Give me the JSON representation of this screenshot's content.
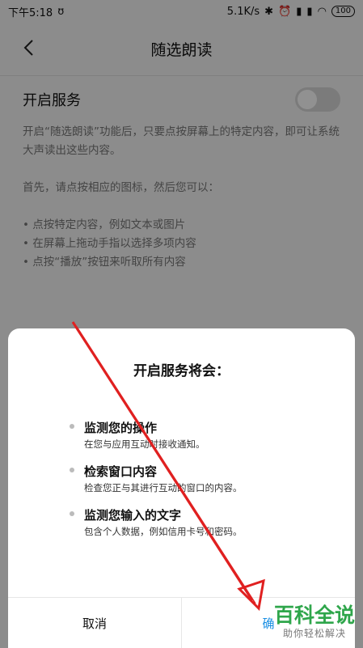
{
  "status_bar": {
    "time": "下午5:18",
    "speed": "5.1K/s",
    "battery": "100"
  },
  "header": {
    "title": "随选朗读"
  },
  "service": {
    "label": "开启服务",
    "enabled": false
  },
  "description": {
    "paragraph1": "开启“随选朗读”功能后，只要点按屏幕上的特定内容，即可让系统大声读出这些内容。",
    "paragraph2": "首先，请点按相应的图标，然后您可以：",
    "bullets": [
      "点按特定内容，例如文本或图片",
      "在屏幕上拖动手指以选择多项内容",
      "点按“播放”按钮来听取所有内容"
    ]
  },
  "dialog": {
    "title": "开启服务将会：",
    "permissions": [
      {
        "title": "监测您的操作",
        "desc": "在您与应用互动时接收通知。"
      },
      {
        "title": "检索窗口内容",
        "desc": "检查您正与其进行互动的窗口的内容。"
      },
      {
        "title": "监测您输入的文字",
        "desc": "包含个人数据，例如信用卡号和密码。"
      }
    ],
    "cancel_label": "取消",
    "confirm_label": "确"
  },
  "watermark": {
    "main": "百科全说",
    "sub": "助你轻松解决"
  },
  "colors": {
    "accent": "#1a8fe3",
    "arrow": "#e02020",
    "watermark": "#2fa64b"
  }
}
